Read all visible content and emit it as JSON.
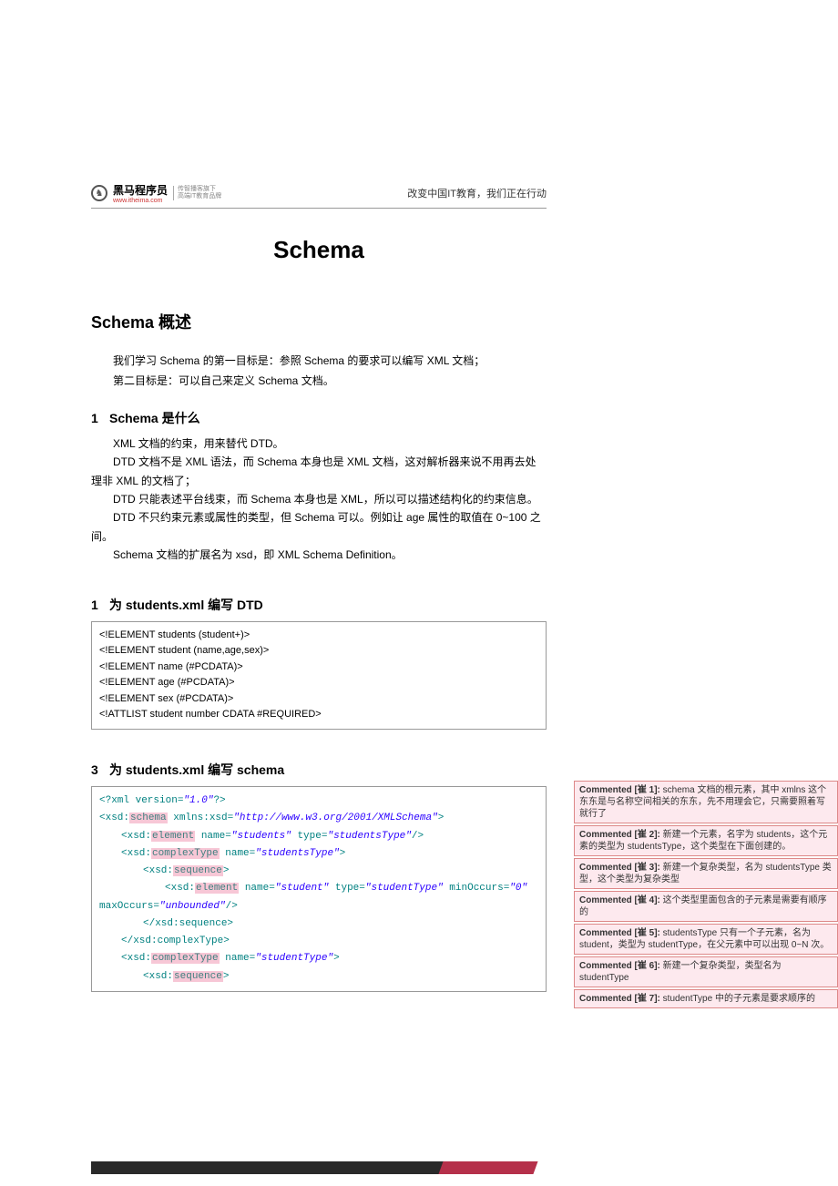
{
  "header": {
    "logo_text": "黑马程序员",
    "logo_sub1": "传智播客旗下",
    "logo_sub2": "高端IT教育品牌",
    "tagline": "改变中国IT教育，我们正在行动"
  },
  "title": "Schema",
  "sec1": {
    "heading": "Schema 概述",
    "p1": "我们学习 Schema 的第一目标是：参照 Schema 的要求可以编写 XML 文档；",
    "p2": "第二目标是：可以自己来定义 Schema 文档。"
  },
  "sec2": {
    "num": "1",
    "heading": "Schema 是什么",
    "p1": "XML 文档的约束，用来替代 DTD。",
    "p2": "DTD 文档不是 XML 语法，而 Schema 本身也是 XML 文档，这对解析器来说不用再去处理非 XML 的文档了；",
    "p3": "DTD 只能表述平台线束，而 Schema 本身也是 XML，所以可以描述结构化的约束信息。",
    "p4": "DTD 不只约束元素或属性的类型，但 Schema 可以。例如让 age 属性的取值在 0~100 之间。",
    "p5": "Schema 文档的扩展名为 xsd，即 XML Schema Definition。"
  },
  "sec3": {
    "num": "1",
    "heading": "为 students.xml 编写 DTD",
    "lines": [
      "<!ELEMENT students (student+)>",
      "<!ELEMENT student (name,age,sex)>",
      "<!ELEMENT name (#PCDATA)>",
      "<!ELEMENT age (#PCDATA)>",
      "<!ELEMENT sex (#PCDATA)>",
      "<!ATTLIST student number CDATA #REQUIRED>"
    ]
  },
  "sec4": {
    "num": "3",
    "heading": "为 students.xml 编写 schema"
  },
  "xml": {
    "l1_a": "<?xml ",
    "l1_b": "version=",
    "l1_c": "\"1.0\"",
    "l1_d": "?>",
    "l2_a": "<xsd:",
    "l2_hl": "schema",
    "l2_b": " xmlns:xsd=",
    "l2_c": "\"http://www.w3.org/2001/XMLSchema\"",
    "l2_d": ">",
    "l3_a": "<xsd:",
    "l3_hl": "element",
    "l3_b": " name=",
    "l3_c": "\"students\"",
    "l3_d": " type=",
    "l3_e": "\"studentsType\"",
    "l3_f": "/>",
    "l4_a": "<xsd:",
    "l4_hl": "complexType",
    "l4_b": " name=",
    "l4_c": "\"studentsType\"",
    "l4_d": ">",
    "l5_a": "<xsd:",
    "l5_hl": "sequence",
    "l5_b": ">",
    "l6_a": "<xsd:",
    "l6_hl": "element",
    "l6_b": " name=",
    "l6_c": "\"student\"",
    "l6_d": " type=",
    "l6_e": "\"studentType\"",
    "l6_f": " minOccurs=",
    "l6_g": "\"0\"",
    "l6b_a": "maxOccurs=",
    "l6b_b": "\"unbounded\"",
    "l6b_c": "/>",
    "l7": "</xsd:sequence>",
    "l8": "</xsd:complexType>",
    "l9_a": "<xsd:",
    "l9_hl": "complexType",
    "l9_b": " name=",
    "l9_c": "\"studentType\"",
    "l9_d": ">",
    "l10_a": "<xsd:",
    "l10_hl": "sequence",
    "l10_b": ">"
  },
  "comments": [
    {
      "label": "Commented [崔 1]:",
      "text": " schema 文档的根元素，其中 xmlns 这个东东是与名称空间相关的东东，先不用理会它，只需要照着写就行了"
    },
    {
      "label": "Commented [崔 2]:",
      "text": " 新建一个元素，名字为 students，这个元素的类型为 studentsType，这个类型在下面创建的。"
    },
    {
      "label": "Commented [崔 3]:",
      "text": " 新建一个复杂类型，名为 studentsType 类型，这个类型为复杂类型"
    },
    {
      "label": "Commented [崔 4]:",
      "text": " 这个类型里面包含的子元素是需要有顺序的"
    },
    {
      "label": "Commented [崔 5]:",
      "text": " studentsType 只有一个子元素，名为 student，类型为 studentType，在父元素中可以出现 0~N 次。"
    },
    {
      "label": "Commented [崔 6]:",
      "text": " 新建一个复杂类型，类型名为 studentType"
    },
    {
      "label": "Commented [崔 7]:",
      "text": " studentType 中的子元素是要求顺序的"
    }
  ]
}
